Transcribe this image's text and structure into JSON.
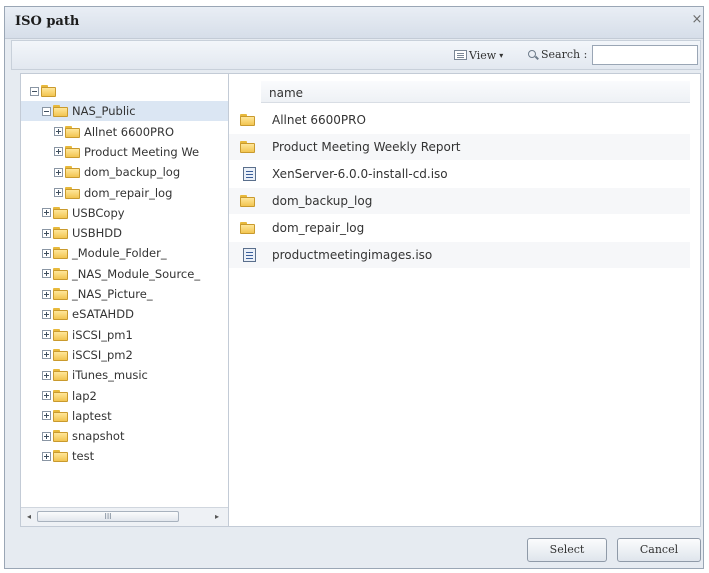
{
  "dialog": {
    "title": "ISO path",
    "close_glyph": "×"
  },
  "toolbar": {
    "view_label": "View",
    "view_caret": "▾",
    "search_label": "Search :",
    "search_value": ""
  },
  "tree": {
    "items": [
      {
        "label": "",
        "level": 0,
        "expander": "minus",
        "selected": false
      },
      {
        "label": "NAS_Public",
        "level": 1,
        "expander": "minus",
        "selected": true
      },
      {
        "label": "Allnet 6600PRO",
        "level": 2,
        "expander": "plus",
        "selected": false
      },
      {
        "label": "Product Meeting We",
        "level": 2,
        "expander": "plus",
        "selected": false
      },
      {
        "label": "dom_backup_log",
        "level": 2,
        "expander": "plus",
        "selected": false
      },
      {
        "label": "dom_repair_log",
        "level": 2,
        "expander": "plus",
        "selected": false
      },
      {
        "label": "USBCopy",
        "level": 1,
        "expander": "plus",
        "selected": false
      },
      {
        "label": "USBHDD",
        "level": 1,
        "expander": "plus",
        "selected": false
      },
      {
        "label": "_Module_Folder_",
        "level": 1,
        "expander": "plus",
        "selected": false
      },
      {
        "label": "_NAS_Module_Source_",
        "level": 1,
        "expander": "plus",
        "selected": false
      },
      {
        "label": "_NAS_Picture_",
        "level": 1,
        "expander": "plus",
        "selected": false
      },
      {
        "label": "eSATAHDD",
        "level": 1,
        "expander": "plus",
        "selected": false
      },
      {
        "label": "iSCSI_pm1",
        "level": 1,
        "expander": "plus",
        "selected": false
      },
      {
        "label": "iSCSI_pm2",
        "level": 1,
        "expander": "plus",
        "selected": false
      },
      {
        "label": "iTunes_music",
        "level": 1,
        "expander": "plus",
        "selected": false
      },
      {
        "label": "lap2",
        "level": 1,
        "expander": "plus",
        "selected": false
      },
      {
        "label": "laptest",
        "level": 1,
        "expander": "plus",
        "selected": false
      },
      {
        "label": "snapshot",
        "level": 1,
        "expander": "plus",
        "selected": false
      },
      {
        "label": "test",
        "level": 1,
        "expander": "plus",
        "selected": false
      }
    ],
    "scroll_left": "◂",
    "scroll_right": "▸",
    "scroll_thumb": "III"
  },
  "files": {
    "column_header": "name",
    "rows": [
      {
        "name": "Allnet 6600PRO",
        "type": "folder"
      },
      {
        "name": "Product Meeting Weekly Report",
        "type": "folder"
      },
      {
        "name": "XenServer-6.0.0-install-cd.iso",
        "type": "iso"
      },
      {
        "name": "dom_backup_log",
        "type": "folder"
      },
      {
        "name": "dom_repair_log",
        "type": "folder"
      },
      {
        "name": "productmeetingimages.iso",
        "type": "iso"
      }
    ]
  },
  "buttons": {
    "select": "Select",
    "cancel": "Cancel"
  }
}
